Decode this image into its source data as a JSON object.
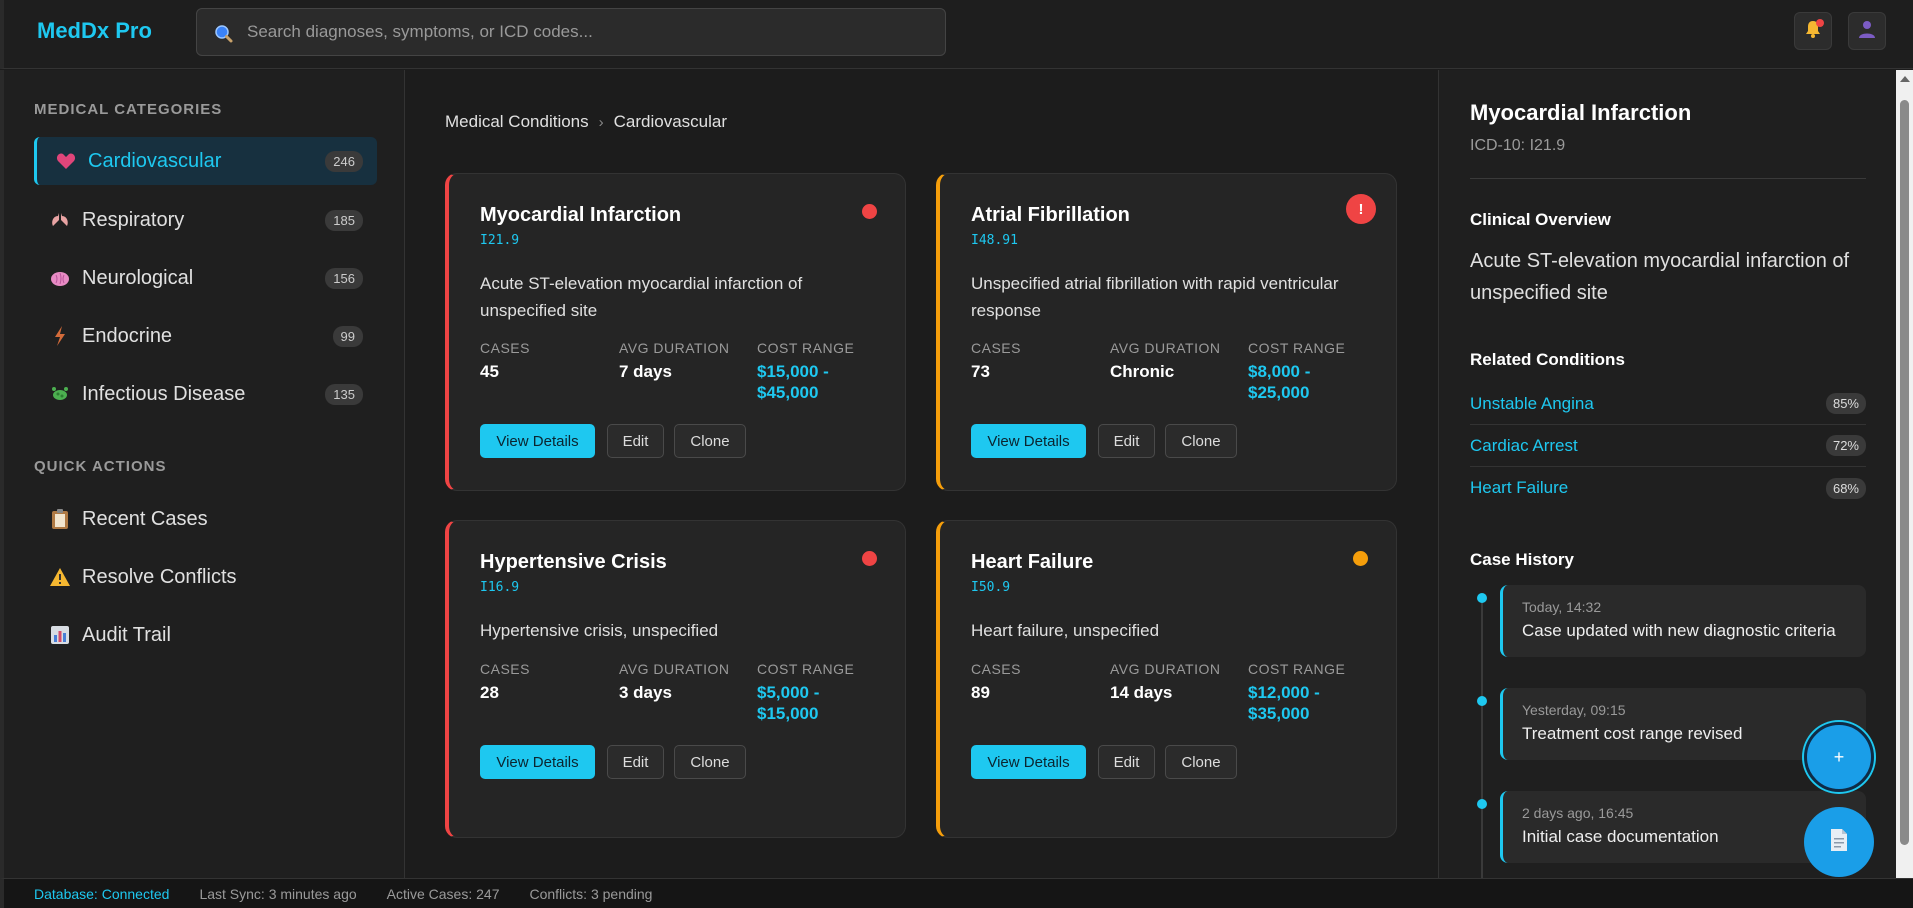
{
  "app": {
    "title": "MedDx Pro"
  },
  "search": {
    "placeholder": "Search diagnoses, symptoms, or ICD codes..."
  },
  "colors": {
    "accent": "#1ec8f0",
    "critical": "#ef4444",
    "warning": "#f59e0b"
  },
  "sidebar": {
    "categories_title": "MEDICAL CATEGORIES",
    "categories": [
      {
        "label": "Cardiovascular",
        "count": "246",
        "icon": "heart-icon",
        "active": true
      },
      {
        "label": "Respiratory",
        "count": "185",
        "icon": "lungs-icon"
      },
      {
        "label": "Neurological",
        "count": "156",
        "icon": "brain-icon"
      },
      {
        "label": "Endocrine",
        "count": "99",
        "icon": "lightning-icon"
      },
      {
        "label": "Infectious Disease",
        "count": "135",
        "icon": "microbe-icon"
      }
    ],
    "actions_title": "QUICK ACTIONS",
    "actions": [
      {
        "label": "Recent Cases",
        "icon": "clipboard-icon"
      },
      {
        "label": "Resolve Conflicts",
        "icon": "warning-icon"
      },
      {
        "label": "Audit Trail",
        "icon": "bar-chart-icon"
      }
    ]
  },
  "breadcrumb": {
    "root": "Medical Conditions",
    "separator": "›",
    "current": "Cardiovascular"
  },
  "cards": [
    {
      "title": "Myocardial Infarction",
      "code": "I21.9",
      "description": "Acute ST-elevation myocardial infarction of unspecified site",
      "cases_label": "CASES",
      "cases": "45",
      "duration_label": "AVG DURATION",
      "duration": "7 days",
      "cost_label": "COST RANGE",
      "cost_line1": "$15,000 -",
      "cost_line2": "$45,000",
      "severity": "red-dot",
      "view_label": "View Details",
      "edit_label": "Edit",
      "clone_label": "Clone"
    },
    {
      "title": "Atrial Fibrillation",
      "code": "I48.91",
      "description": "Unspecified atrial fibrillation with rapid ventricular response",
      "cases_label": "CASES",
      "cases": "73",
      "duration_label": "AVG DURATION",
      "duration": "Chronic",
      "cost_label": "COST RANGE",
      "cost_line1": "$8,000 -",
      "cost_line2": "$25,000",
      "severity": "alert",
      "alert_symbol": "!",
      "view_label": "View Details",
      "edit_label": "Edit",
      "clone_label": "Clone"
    },
    {
      "title": "Hypertensive Crisis",
      "code": "I16.9",
      "description": "Hypertensive crisis, unspecified",
      "cases_label": "CASES",
      "cases": "28",
      "duration_label": "AVG DURATION",
      "duration": "3 days",
      "cost_label": "COST RANGE",
      "cost_line1": "$5,000 -",
      "cost_line2": "$15,000",
      "severity": "red-dot",
      "view_label": "View Details",
      "edit_label": "Edit",
      "clone_label": "Clone"
    },
    {
      "title": "Heart Failure",
      "code": "I50.9",
      "description": "Heart failure, unspecified",
      "cases_label": "CASES",
      "cases": "89",
      "duration_label": "AVG DURATION",
      "duration": "14 days",
      "cost_label": "COST RANGE",
      "cost_line1": "$12,000 -",
      "cost_line2": "$35,000",
      "severity": "orange-dot",
      "view_label": "View Details",
      "edit_label": "Edit",
      "clone_label": "Clone"
    }
  ],
  "detail": {
    "title": "Myocardial Infarction",
    "icd": "ICD-10: I21.9",
    "overview_heading": "Clinical Overview",
    "overview": "Acute ST-elevation myocardial infarction of unspecified site",
    "related_heading": "Related Conditions",
    "related": [
      {
        "name": "Unstable Angina",
        "pct": "85%"
      },
      {
        "name": "Cardiac Arrest",
        "pct": "72%"
      },
      {
        "name": "Heart Failure",
        "pct": "68%"
      }
    ],
    "history_heading": "Case History",
    "history": [
      {
        "time": "Today, 14:32",
        "message": "Case updated with new diagnostic criteria"
      },
      {
        "time": "Yesterday, 09:15",
        "message": "Treatment cost range revised"
      },
      {
        "time": "2 days ago, 16:45",
        "message": "Initial case documentation"
      }
    ]
  },
  "fab": {
    "add_symbol": "+"
  },
  "status": {
    "database": "Database: Connected",
    "sync": "Last Sync: 3 minutes ago",
    "active": "Active Cases: 247",
    "conflicts": "Conflicts: 3 pending"
  }
}
